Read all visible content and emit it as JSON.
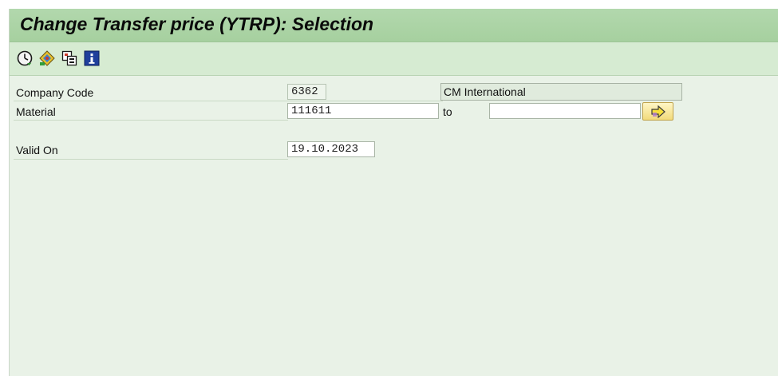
{
  "header": {
    "title": "Change Transfer price (YTRP): Selection"
  },
  "toolbar": {
    "buttons": [
      {
        "icon": "execute-clock-icon"
      },
      {
        "icon": "get-variant-icon"
      },
      {
        "icon": "copy-variant-icon"
      },
      {
        "icon": "info-icon"
      }
    ]
  },
  "form": {
    "company_code": {
      "label": "Company Code",
      "value": "6362",
      "description": "CM International"
    },
    "material": {
      "label": "Material",
      "from_value": "111611",
      "to_label": "to",
      "to_value": ""
    },
    "valid_on": {
      "label": "Valid On",
      "value": "19.10.2023"
    }
  }
}
